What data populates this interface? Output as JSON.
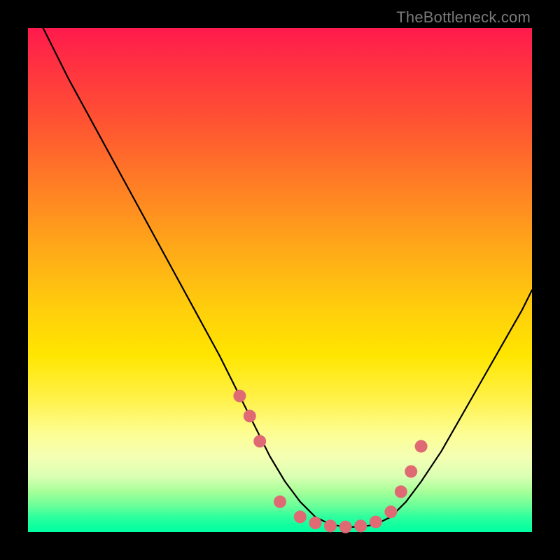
{
  "watermark": "TheBottleneck.com",
  "chart_data": {
    "type": "line",
    "title": "",
    "xlabel": "",
    "ylabel": "",
    "xlim": [
      0,
      100
    ],
    "ylim": [
      0,
      100
    ],
    "series": [
      {
        "name": "bottleneck-curve",
        "x": [
          3,
          8,
          14,
          20,
          26,
          32,
          38,
          42,
          45,
          48,
          51,
          54,
          57,
          60,
          63,
          66,
          69,
          72,
          75,
          78,
          82,
          86,
          90,
          94,
          98,
          100
        ],
        "y": [
          100,
          90,
          79,
          68,
          57,
          46,
          35,
          27,
          21,
          15,
          10,
          6,
          3,
          1.5,
          1,
          1,
          1.5,
          3,
          6,
          10,
          16,
          23,
          30,
          37,
          44,
          48
        ]
      }
    ],
    "markers": {
      "name": "highlight-dots",
      "color": "#e06a74",
      "radius": 9,
      "x": [
        42,
        44,
        46,
        50,
        54,
        57,
        60,
        63,
        66,
        69,
        72,
        74,
        76,
        78
      ],
      "y": [
        27,
        23,
        18,
        6,
        3,
        1.8,
        1.2,
        1,
        1.2,
        2,
        4,
        8,
        12,
        17
      ]
    }
  }
}
